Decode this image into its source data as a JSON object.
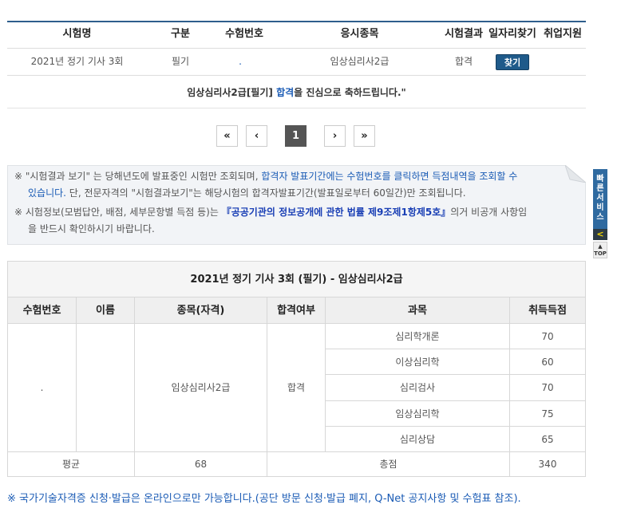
{
  "exam_table": {
    "headers": [
      "시험명",
      "구분",
      "수험번호",
      "응시종목",
      "시험결과",
      "일자리찾기",
      "취업지원"
    ],
    "row": {
      "exam_name": "2021년 정기 기사 3회",
      "category": "필기",
      "exam_number": ".",
      "subject": "임상심리사2급",
      "result": "합격",
      "find_button": "찾기"
    },
    "congrats_prefix": "임상심리사2급[필기] ",
    "congrats_pass": "합격",
    "congrats_suffix": "을 진심으로 축하드립니다.\""
  },
  "pagination": {
    "first": "«",
    "prev": "‹",
    "current": "1",
    "next": "›",
    "last": "»"
  },
  "notice": {
    "line1_a": "※ \"시험결과 보기\" 는 당해년도에 발표중인 시험만 조회되며, ",
    "line1_b": "합격자 발표기간에는 수험번호를 클릭하면 득점내역을 조회할 수",
    "line2_b": "있습니다.",
    "line2_c": " 단, 전문자격의 \"시험결과보기\"는 해당시험의 합격자발표기간(발표일로부터 60일간)만 조회됩니다.",
    "line3_a": "※ 시험정보(모범답안, 배점, 세부문항별 득점 등)는 ",
    "line3_b": "『공공기관의 정보공개에 관한 법률 제9조제1항제5호』",
    "line3_c": "의거 비공개 사항임",
    "line4": "을 반드시 확인하시기 바랍니다."
  },
  "quick_menu": {
    "label": "빠른서비스",
    "arrow": "<",
    "top": "TOP"
  },
  "result_table": {
    "title": "2021년 정기 기사 3회 (필기) - 임상심리사2급",
    "headers": [
      "수험번호",
      "이름",
      "종목(자격)",
      "합격여부",
      "과목",
      "취득득점"
    ],
    "exam_number": ".",
    "license": "임상심리사2급",
    "pass": "합격",
    "subjects": [
      {
        "name": "심리학개론",
        "score": "70"
      },
      {
        "name": "이상심리학",
        "score": "60"
      },
      {
        "name": "심리검사",
        "score": "70"
      },
      {
        "name": "임상심리학",
        "score": "75"
      },
      {
        "name": "심리상담",
        "score": "65"
      }
    ],
    "avg_label": "평균",
    "avg_value": "68",
    "total_label": "총점",
    "total_value": "340"
  },
  "footnote": "※ 국가기술자격증 신청·발급은 온라인으로만 가능합니다.(공단 방문 신청·발급 폐지, Q-Net 공지사항 및 수험표 참조)."
}
